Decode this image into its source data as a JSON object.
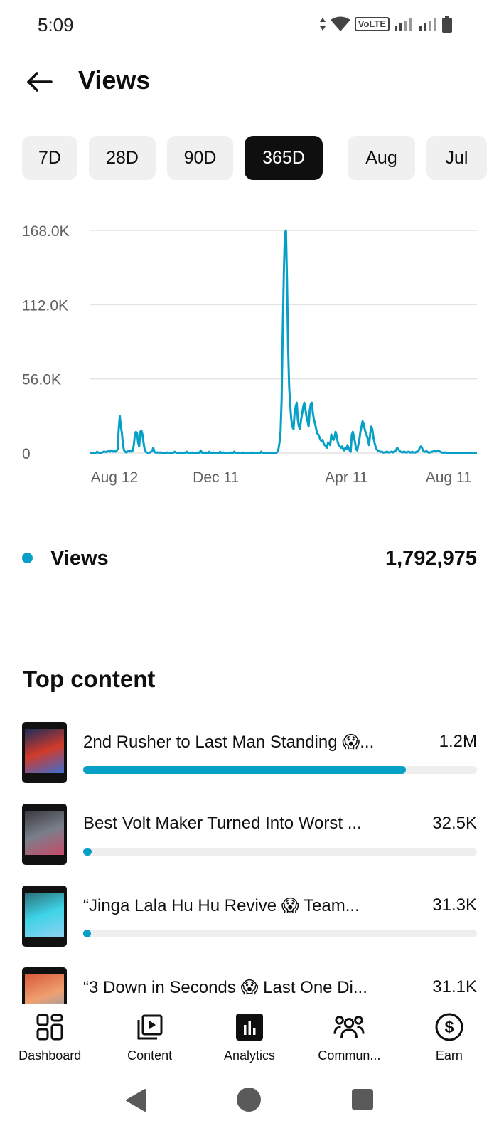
{
  "status_bar": {
    "time": "5:09",
    "network_label": "VoLTE"
  },
  "header": {
    "title": "Views"
  },
  "period_tabs": [
    {
      "label": "7D",
      "active": false
    },
    {
      "label": "28D",
      "active": false
    },
    {
      "label": "90D",
      "active": false
    },
    {
      "label": "365D",
      "active": true
    },
    {
      "label": "Aug",
      "active": false
    },
    {
      "label": "Jul",
      "active": false
    }
  ],
  "chart_data": {
    "type": "line",
    "series": [
      {
        "values": [
          0,
          0,
          0,
          0,
          0,
          0,
          200,
          1000,
          500,
          0,
          0,
          200,
          600,
          1000,
          1000,
          900,
          800,
          1500,
          1500,
          1000,
          2000,
          1500,
          1000,
          1500,
          1000,
          1500,
          3000,
          18000,
          28000,
          20000,
          15000,
          6000,
          2000,
          1000,
          500,
          1000,
          1500,
          1000,
          2000,
          1000,
          2000,
          6000,
          14000,
          16000,
          15000,
          8000,
          5000,
          16000,
          17000,
          14000,
          8000,
          3000,
          1000,
          500,
          200,
          300,
          500,
          1000,
          1500,
          4000,
          1000,
          500,
          200,
          500,
          500,
          300,
          500,
          200,
          0,
          0,
          0,
          200,
          500,
          0,
          200,
          0,
          0,
          0,
          500,
          1000,
          500,
          0,
          300,
          0,
          500,
          200,
          0,
          0,
          500,
          0,
          1000,
          300,
          0,
          300,
          0,
          500,
          0,
          200,
          0,
          300,
          0,
          500,
          0,
          2000,
          500,
          0,
          300,
          0,
          500,
          0,
          0,
          1000,
          0,
          300,
          0,
          500,
          0,
          200,
          0,
          300,
          0,
          1000,
          200,
          0,
          500,
          0,
          300,
          0,
          0,
          200,
          0,
          500,
          0,
          0,
          1000,
          500,
          0,
          0,
          300,
          0,
          200,
          0,
          500,
          0,
          0,
          0,
          300,
          0,
          200,
          0,
          0,
          500,
          0,
          0,
          200,
          0,
          0,
          300,
          0,
          1000,
          500,
          0,
          0,
          0,
          500,
          0,
          0,
          200,
          0,
          0,
          0,
          300,
          0,
          0,
          1000,
          3000,
          8000,
          16000,
          40000,
          90000,
          135000,
          166000,
          168000,
          130000,
          80000,
          50000,
          35000,
          25000,
          20000,
          18000,
          30000,
          35000,
          38000,
          25000,
          20000,
          18000,
          25000,
          30000,
          35000,
          38000,
          33000,
          28000,
          24000,
          20000,
          32000,
          37000,
          38000,
          30000,
          25000,
          22000,
          18000,
          15000,
          14000,
          12000,
          10000,
          9000,
          10000,
          7000,
          6000,
          5000,
          4000,
          8000,
          7000,
          6000,
          14000,
          11000,
          10000,
          12000,
          16000,
          13000,
          8000,
          6000,
          5000,
          4000,
          5000,
          3000,
          2000,
          4000,
          3000,
          6000,
          4000,
          2000,
          1000,
          14000,
          16000,
          12000,
          8000,
          3000,
          2000,
          6000,
          10000,
          16000,
          20000,
          24000,
          22000,
          18000,
          15000,
          13000,
          10000,
          6000,
          14000,
          20000,
          18000,
          12000,
          8000,
          5000,
          3000,
          2000,
          1500,
          1000,
          1000,
          1000,
          500,
          500,
          500,
          1000,
          1000,
          500,
          500,
          1000,
          1000,
          500,
          1000,
          1500,
          2000,
          4000,
          3000,
          2000,
          1000,
          1000,
          500,
          1000,
          1000,
          500,
          500,
          1000,
          1000,
          500,
          500,
          1000,
          500,
          500,
          500,
          1000,
          1000,
          2000,
          4000,
          5000,
          4000,
          2000,
          1000,
          1000,
          1500,
          1000,
          500,
          500,
          500,
          1000,
          1000,
          1500,
          1500,
          1000,
          1500,
          2000,
          1500,
          1000,
          500,
          500,
          0,
          500,
          500,
          0,
          0,
          0,
          0,
          0,
          0,
          0,
          0,
          0,
          0,
          0,
          0,
          0,
          0,
          0,
          0,
          0,
          0,
          0,
          0,
          0,
          0,
          0,
          0,
          0,
          0,
          0,
          0,
          0
        ]
      }
    ],
    "x_tick_labels": [
      "Aug 12",
      "Dec 11",
      "Apr 11",
      "Aug 11"
    ],
    "y_tick_labels": [
      "0",
      "56.0K",
      "112.0K",
      "168.0K"
    ],
    "ylim": [
      0,
      168000
    ],
    "grid": true,
    "color": "#06a0c7"
  },
  "legend": {
    "label": "Views",
    "total": "1,792,975",
    "color": "#06a0c7"
  },
  "top_content": {
    "title": "Top content",
    "items": [
      {
        "title": "2nd Rusher to Last Man Standing 😱...",
        "value": "1.2M",
        "share": 0.82,
        "thumb_colors": [
          "#1c2d5a",
          "#d23a2a",
          "#3b6fd0"
        ]
      },
      {
        "title": "Best Volt Maker Turned Into Worst ...",
        "value": "32.5K",
        "share": 0.021,
        "thumb_colors": [
          "#3a3a40",
          "#7a7f8a",
          "#c94a6a"
        ]
      },
      {
        "title": "“Jinga Lala Hu Hu Revive 😱 Team...",
        "value": "31.3K",
        "share": 0.02,
        "thumb_colors": [
          "#2b6f78",
          "#3fd4e8",
          "#8fd0f0"
        ]
      },
      {
        "title": "“3 Down in Seconds 😱 Last One Di...",
        "value": "31.1K",
        "share": 0.02,
        "thumb_colors": [
          "#d85a3a",
          "#f0a070",
          "#6fa0c0"
        ]
      }
    ]
  },
  "bottom_nav": [
    {
      "label": "Dashboard",
      "icon": "dashboard-icon"
    },
    {
      "label": "Content",
      "icon": "content-icon"
    },
    {
      "label": "Analytics",
      "icon": "analytics-icon"
    },
    {
      "label": "Commun...",
      "icon": "community-icon"
    },
    {
      "label": "Earn",
      "icon": "earn-icon"
    }
  ]
}
